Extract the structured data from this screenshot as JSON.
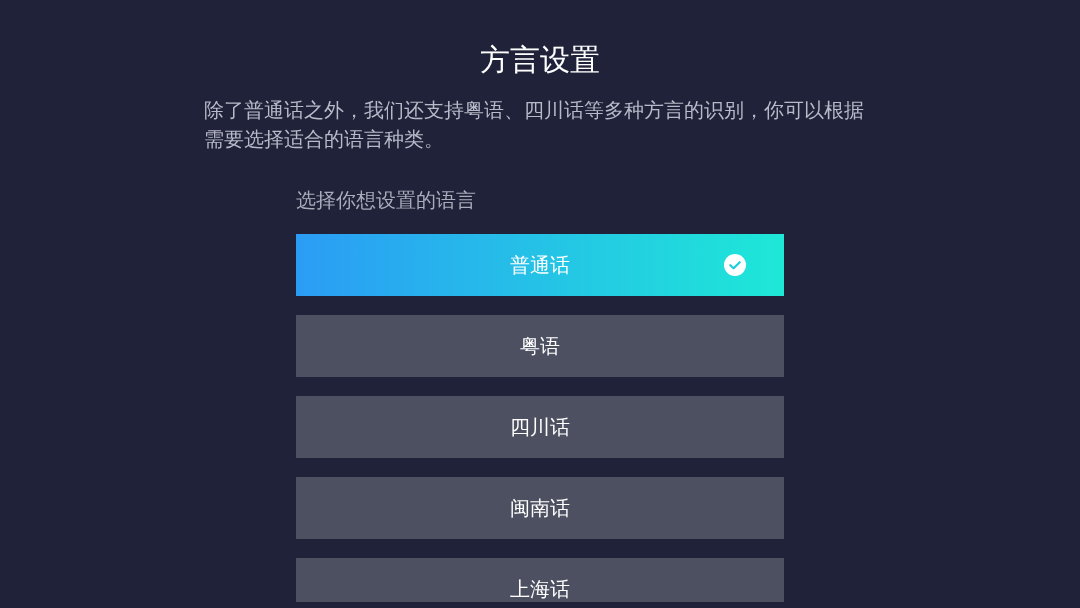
{
  "title": "方言设置",
  "description": "除了普通话之外，我们还支持粤语、四川话等多种方言的识别，你可以根据需要选择适合的语言种类。",
  "prompt": "选择你想设置的语言",
  "languages": [
    {
      "label": "普通话",
      "selected": true
    },
    {
      "label": "粤语",
      "selected": false
    },
    {
      "label": "四川话",
      "selected": false
    },
    {
      "label": "闽南话",
      "selected": false
    },
    {
      "label": "上海话",
      "selected": false
    }
  ]
}
